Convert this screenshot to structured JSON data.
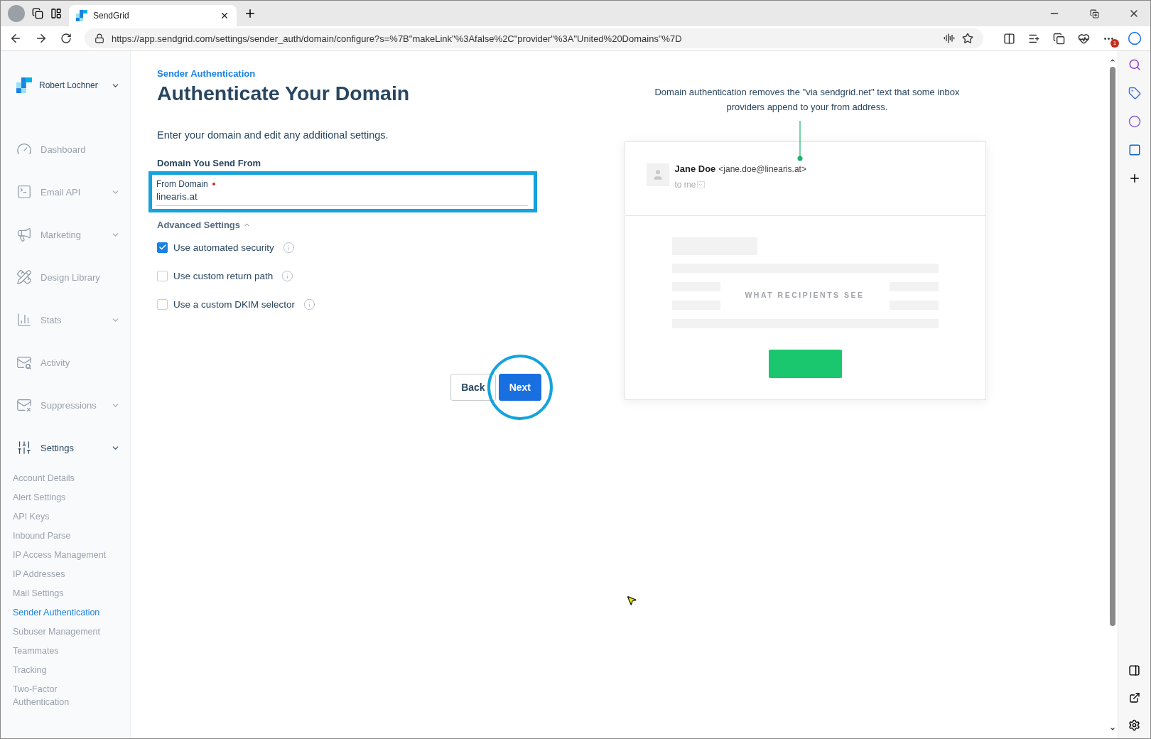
{
  "browser": {
    "tabs": [
      {
        "title": "SendGrid",
        "selected": true
      }
    ],
    "url": "https://app.sendgrid.com/settings/sender_auth/domain/configure?s=%7B\"makeLink\"%3Afalse%2C\"provider\"%3A\"United%20Domains\"%7D",
    "notification_count": "1"
  },
  "sidebar": {
    "account": "Robert Lochner",
    "items": [
      {
        "label": "Dashboard",
        "expandable": false,
        "expanded": false
      },
      {
        "label": "Email API",
        "expandable": true,
        "expanded": false
      },
      {
        "label": "Marketing",
        "expandable": true,
        "expanded": false
      },
      {
        "label": "Design Library",
        "expandable": false,
        "expanded": false
      },
      {
        "label": "Stats",
        "expandable": true,
        "expanded": false
      },
      {
        "label": "Activity",
        "expandable": false,
        "expanded": false
      },
      {
        "label": "Suppressions",
        "expandable": true,
        "expanded": false
      },
      {
        "label": "Settings",
        "expandable": true,
        "expanded": true,
        "children": [
          {
            "label": "Account Details",
            "selected": false
          },
          {
            "label": "Alert Settings",
            "selected": false
          },
          {
            "label": "API Keys",
            "selected": false
          },
          {
            "label": "Inbound Parse",
            "selected": false
          },
          {
            "label": "IP Access Management",
            "selected": false
          },
          {
            "label": "IP Addresses",
            "selected": false
          },
          {
            "label": "Mail Settings",
            "selected": false
          },
          {
            "label": "Sender Authentication",
            "selected": true
          },
          {
            "label": "Subuser Management",
            "selected": false
          },
          {
            "label": "Teammates",
            "selected": false
          },
          {
            "label": "Tracking",
            "selected": false
          },
          {
            "label": "Two-Factor Authentication",
            "selected": false
          }
        ]
      }
    ]
  },
  "page": {
    "breadcrumb": "Sender Authentication",
    "title": "Authenticate Your Domain",
    "intro": "Enter your domain and edit any additional settings.",
    "section_label": "Domain You Send From",
    "field": {
      "label": "From Domain",
      "required": true,
      "value": "linearis.at"
    },
    "advanced": {
      "label": "Advanced Settings",
      "expanded": true
    },
    "options": [
      {
        "label": "Use automated security",
        "checked": true
      },
      {
        "label": "Use custom return path",
        "checked": false
      },
      {
        "label": "Use a custom DKIM selector",
        "checked": false
      }
    ],
    "buttons": [
      {
        "label": "Back",
        "kind": "secondary"
      },
      {
        "label": "Next",
        "kind": "primary"
      }
    ]
  },
  "preview": {
    "description": "Domain authentication removes the \"via sendgrid.net\" text that some inbox providers append to your from address.",
    "sender_name": "Jane Doe",
    "sender_email": "<jane.doe@linearis.at>",
    "recipient": "to me",
    "overlay_label": "WHAT RECIPIENTS SEE"
  }
}
